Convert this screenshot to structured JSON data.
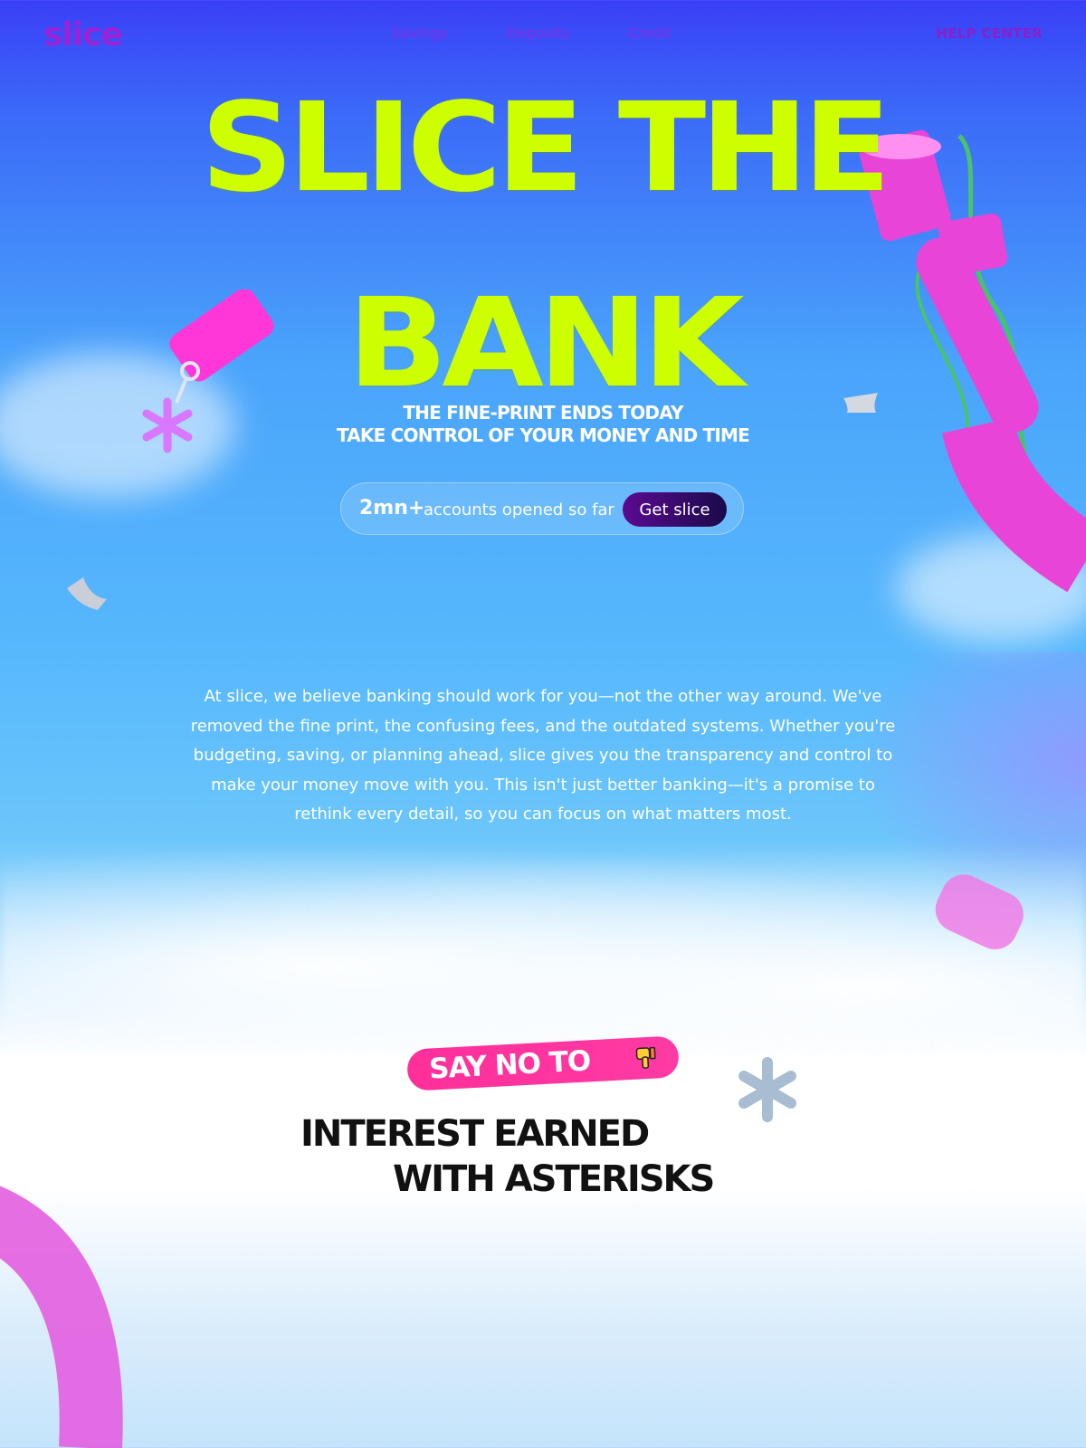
{
  "nav": {
    "logo": "slice",
    "links": [
      "Savings",
      "Deposits",
      "Credit"
    ],
    "help": "HELP CENTER"
  },
  "hero": {
    "title_line1": "SLICE THE",
    "title_line2": "BANK",
    "subtitle_line1": "THE FINE-PRINT ENDS TODAY",
    "subtitle_line2": "TAKE CONTROL OF YOUR MONEY AND TIME"
  },
  "stats": {
    "count": "2mn+",
    "text": "accounts opened so far",
    "cta": "Get slice"
  },
  "intro": "At slice, we believe banking should work for you—not the other way around.  We've removed the fine print, the confusing fees, and the outdated systems. Whether you're budgeting, saving, or planning ahead, slice gives you the transparency and control to make your money move with you. This isn't just better banking—it's a promise to rethink every detail, so you can focus on what matters most.",
  "say_no": {
    "badge": "SAY NO TO",
    "line1": "INTEREST EARNED",
    "line2": "WITH ASTERISKS"
  },
  "colors": {
    "accent_lime": "#cdff00",
    "accent_pink": "#ff2f9a",
    "accent_purple": "#9b22d6"
  }
}
